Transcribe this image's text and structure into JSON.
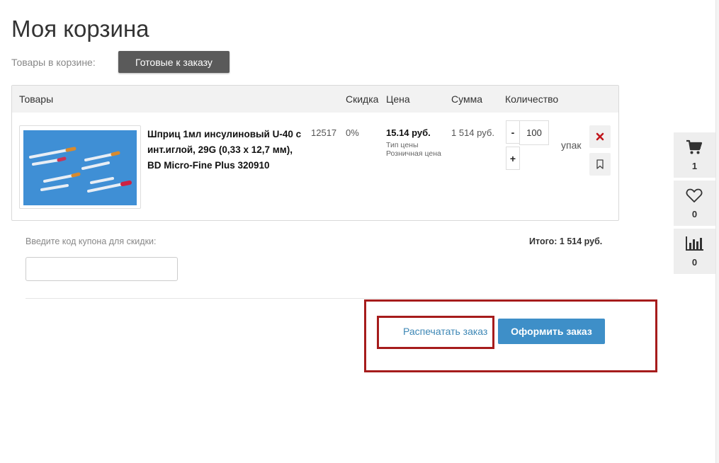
{
  "page": {
    "title": "Моя корзина"
  },
  "tabs": {
    "cart_label": "Товары в корзине:",
    "ready_label": "Готовые к заказу"
  },
  "table": {
    "headers": {
      "goods": "Товары",
      "discount": "Скидка",
      "price": "Цена",
      "sum": "Сумма",
      "quantity": "Количество"
    },
    "row": {
      "name": "Шприц 1мл инсулиновый U-40 с инт.иглой, 29G (0,33 x 12,7 мм), BD Micro-Fine Plus 320910",
      "code": "12517",
      "discount": "0%",
      "price": "15.14 руб.",
      "price_type_label": "Тип цены",
      "price_type_value": "Розничная цена",
      "sum": "1 514 руб.",
      "qty_minus": "-",
      "qty_plus": "+",
      "quantity": "100",
      "unit": "упак"
    }
  },
  "coupon": {
    "label": "Введите код купона для скидки:",
    "value": ""
  },
  "total": {
    "label": "Итого:",
    "value": "1 514 руб."
  },
  "actions": {
    "print": "Распечатать заказ",
    "checkout": "Оформить заказ"
  },
  "sidebar": {
    "cart_count": "1",
    "favorites_count": "0",
    "compare_count": "0"
  },
  "colors": {
    "accent": "#3e8fc8",
    "highlight": "#a61c1c",
    "remove": "#c0161c"
  }
}
